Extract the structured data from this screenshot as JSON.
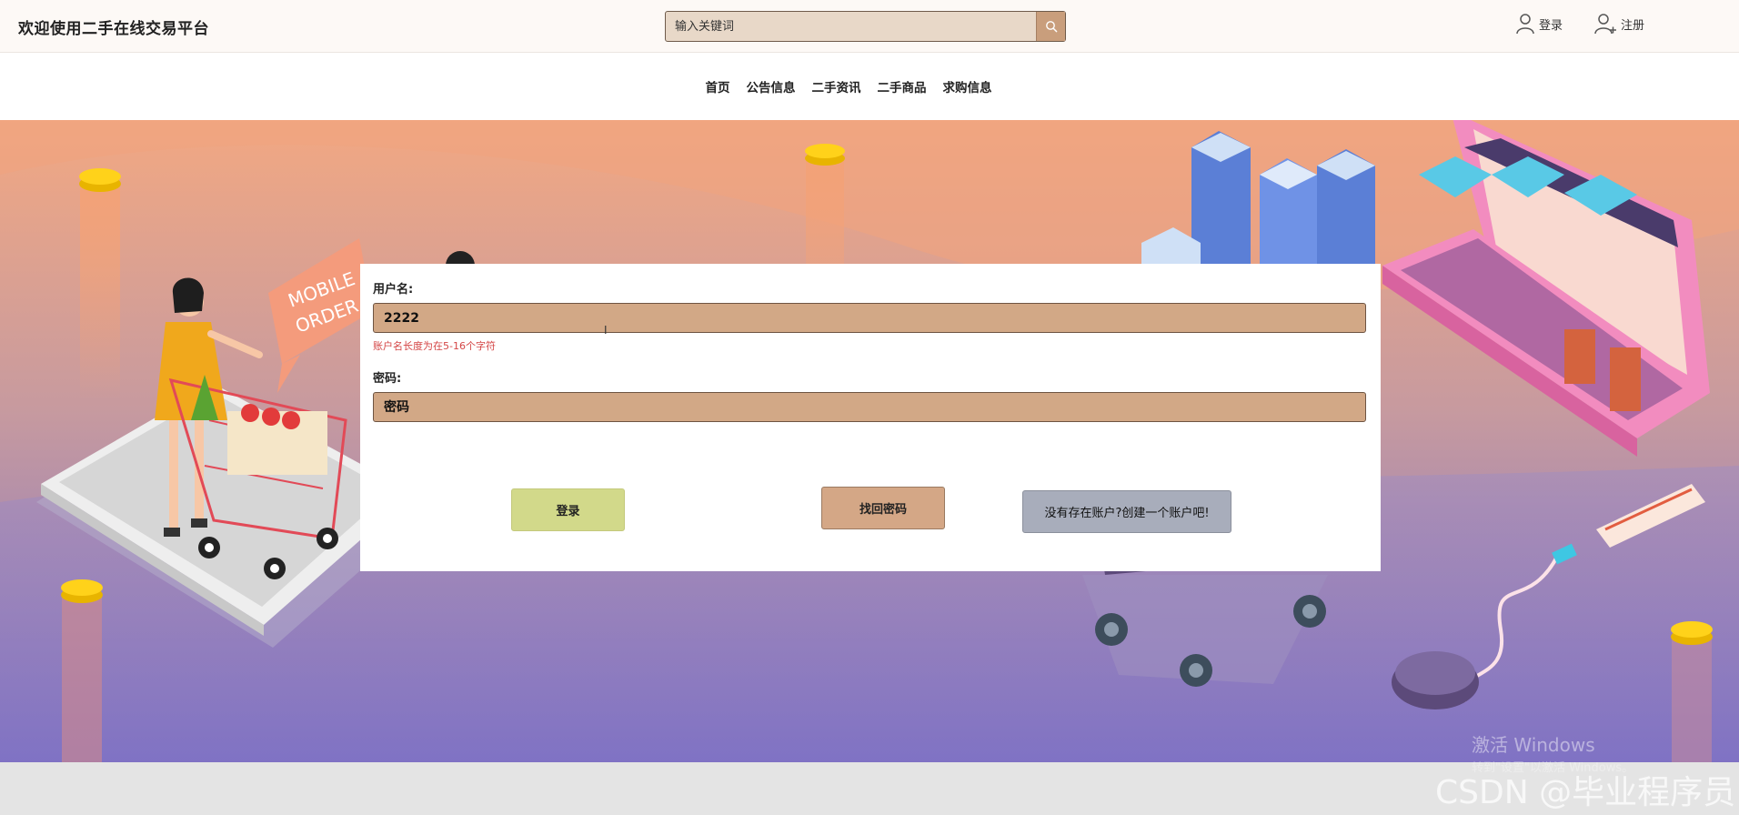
{
  "header": {
    "site_title": "欢迎使用二手在线交易平台",
    "search_placeholder": "输入关键词",
    "search_icon": "search-icon",
    "login_label": "登录",
    "register_label": "注册"
  },
  "nav": {
    "items": [
      "首页",
      "公告信息",
      "二手资讯",
      "二手商品",
      "求购信息"
    ]
  },
  "hero": {
    "sign_text_line1": "MOBILE",
    "sign_text_line2": "ORDER"
  },
  "login_form": {
    "username_label": "用户名:",
    "username_value": "2222",
    "username_error": "账户名长度为在5-16个字符",
    "password_label": "密码:",
    "password_placeholder": "密码",
    "login_button": "登录",
    "forgot_button": "找回密码",
    "create_account_button": "没有存在账户?创建一个账户吧!"
  },
  "watermarks": {
    "windows_activate": "激活 Windows",
    "windows_activate_sub": "转到\"设置\"以激活 Windows。",
    "csdn": "CSDN @毕业程序员"
  },
  "colors": {
    "input_bg": "#d2a886",
    "login_button_bg": "#d2d98a",
    "forgot_button_bg": "#d4a786",
    "create_button_bg": "#a8adbb",
    "error_text": "#d44545"
  }
}
